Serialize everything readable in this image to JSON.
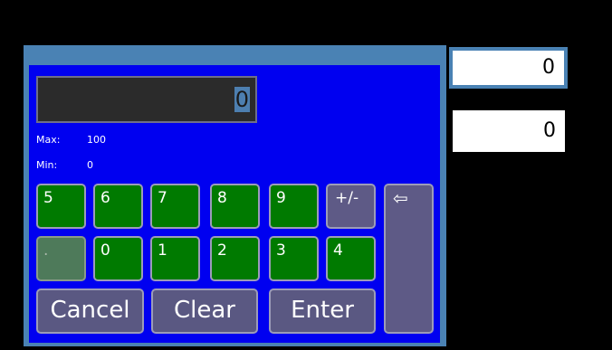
{
  "keypad": {
    "display_value": "0",
    "max_label": "Max:",
    "max_value": "100",
    "min_label": "Min:",
    "min_value": "0",
    "row1": [
      "5",
      "6",
      "7",
      "8",
      "9",
      "+/-"
    ],
    "row2": [
      ".",
      "0",
      "1",
      "2",
      "3",
      "4"
    ],
    "backspace_glyph": "⇦",
    "cancel_label": "Cancel",
    "clear_label": "Clear",
    "enter_label": "Enter"
  },
  "fields": {
    "field1_value": "0",
    "field2_value": "0"
  }
}
